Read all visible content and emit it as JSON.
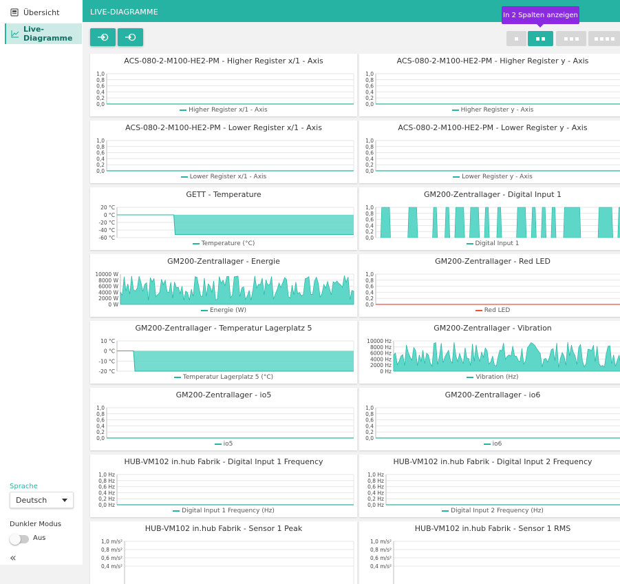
{
  "sidebar": {
    "items": [
      {
        "label": "Übersicht",
        "icon": "overview-icon",
        "active": false
      },
      {
        "label": "Live-Diagramme",
        "icon": "chart-line-icon",
        "active": true
      }
    ],
    "language_label": "Sprache",
    "language_value": "Deutsch",
    "dark_mode_label": "Dunkler Modus",
    "dark_mode_value": "Aus",
    "collapse_icon": "double-chevron-left-icon"
  },
  "header": {
    "title": "LIVE-DIAGRAMME",
    "tooltip": "In 2 Spalten anzeigen"
  },
  "toolbar": {
    "buttons": [
      "login-icon",
      "import-icon"
    ],
    "column_options": [
      1,
      2,
      3,
      4
    ],
    "selected_columns": 2
  },
  "colors": {
    "accent": "#26b3a3",
    "series": "#5ed6c8",
    "red": "#e0533f",
    "tooltip": "#8a2be2"
  },
  "charts": [
    {
      "title": "ACS-080-2-M100-HE2-PM - Higher Register x/1 - Axis",
      "legend": "Higher Register x/1 - Axis",
      "yticks": [
        "1,0",
        "0,8",
        "0,6",
        "0,4",
        "0,2",
        "0,0"
      ],
      "kind": "flat",
      "color": "#26b3a3"
    },
    {
      "title": "ACS-080-2-M100-HE2-PM - Higher Register y - Axis",
      "legend": "Higher Register y - Axis",
      "yticks": [
        "1,0",
        "0,8",
        "0,6",
        "0,4",
        "0,2",
        "0,0"
      ],
      "kind": "flat",
      "color": "#26b3a3"
    },
    {
      "title": "ACS-080-2-M100-HE2-PM - Lower Register x/1 - Axis",
      "legend": "Lower Register x/1 - Axis",
      "yticks": [
        "1,0",
        "0,8",
        "0,6",
        "0,4",
        "0,2",
        "0,0"
      ],
      "kind": "flat",
      "color": "#26b3a3"
    },
    {
      "title": "ACS-080-2-M100-HE2-PM - Lower Register y - Axis",
      "legend": "Lower Register y - Axis",
      "yticks": [
        "1,0",
        "0,8",
        "0,6",
        "0,4",
        "0,2",
        "0,0"
      ],
      "kind": "flat",
      "color": "#26b3a3"
    },
    {
      "title": "GETT - Temperature",
      "legend": "Temperature (°C)",
      "yticks": [
        "20 °C",
        "0 °C",
        "-20 °C",
        "-40 °C",
        "-60 °C"
      ],
      "kind": "temp",
      "step_at": 0.24,
      "drop_to": 0.9,
      "zero": 0.25,
      "color": "#26b3a3"
    },
    {
      "title": "GM200-Zentrallager - Digital Input 1",
      "legend": "Digital Input 1",
      "yticks": [
        "1,0",
        "0,8",
        "0,6",
        "0,4",
        "0,2",
        "0,0"
      ],
      "kind": "pulses",
      "pulses": [
        [
          0.02,
          0.06
        ],
        [
          0.13,
          0.17
        ],
        [
          0.23,
          0.25
        ],
        [
          0.28,
          0.3
        ],
        [
          0.32,
          0.36
        ],
        [
          0.38,
          0.42
        ],
        [
          0.44,
          0.46
        ],
        [
          0.49,
          0.51
        ],
        [
          0.57,
          0.61
        ],
        [
          0.63,
          0.65
        ],
        [
          0.67,
          0.69
        ],
        [
          0.71,
          0.73
        ],
        [
          0.76,
          0.83
        ],
        [
          0.9,
          0.96
        ],
        [
          0.98,
          1.0
        ]
      ],
      "color": "#26b3a3"
    },
    {
      "title": "GM200-Zentrallager - Energie",
      "legend": "Energie (W)",
      "yticks": [
        "10000 W",
        "8000 W",
        "6000 W",
        "4000 W",
        "2000 W",
        "0 W"
      ],
      "kind": "noisy",
      "seed": 3,
      "color": "#26b3a3"
    },
    {
      "title": "GM200-Zentrallager - Red LED",
      "legend": "Red LED",
      "yticks": [
        "1,0",
        "0,8",
        "0,6",
        "0,4",
        "0,2",
        "0,0"
      ],
      "kind": "flat",
      "color": "#e0533f"
    },
    {
      "title": "GM200-Zentrallager - Temperatur Lagerplatz 5",
      "legend": "Temperatur Lagerplatz 5 (°C)",
      "yticks": [
        "10 °C",
        "0 °C",
        "-10 °C",
        "-20 °C"
      ],
      "kind": "temp",
      "step_at": 0.07,
      "drop_to": 1.0,
      "zero": 0.33,
      "color": "#26b3a3"
    },
    {
      "title": "GM200-Zentrallager - Vibration",
      "legend": "Vibration (Hz)",
      "yticks": [
        "10000 Hz",
        "8000 Hz",
        "6000 Hz",
        "4000 Hz",
        "2000 Hz",
        "0 Hz"
      ],
      "kind": "noisy",
      "seed": 7,
      "color": "#26b3a3"
    },
    {
      "title": "GM200-Zentrallager - io5",
      "legend": "io5",
      "yticks": [
        "1,0",
        "0,8",
        "0,6",
        "0,4",
        "0,2",
        "0,0"
      ],
      "kind": "flat",
      "color": "#26b3a3"
    },
    {
      "title": "GM200-Zentrallager - io6",
      "legend": "io6",
      "yticks": [
        "1,0",
        "0,8",
        "0,6",
        "0,4",
        "0,2",
        "0,0"
      ],
      "kind": "flat",
      "color": "#26b3a3"
    },
    {
      "title": "HUB-VM102 in.hub Fabrik - Digital Input 1 Frequency",
      "legend": "Digital Input 1 Frequency (Hz)",
      "yticks": [
        "1,0 Hz",
        "0,8 Hz",
        "0,6 Hz",
        "0,4 Hz",
        "0,2 Hz",
        "0,0 Hz"
      ],
      "kind": "flat",
      "color": "#26b3a3"
    },
    {
      "title": "HUB-VM102 in.hub Fabrik - Digital Input 2 Frequency",
      "legend": "Digital Input 2 Frequency (Hz)",
      "yticks": [
        "1,0 Hz",
        "0,8 Hz",
        "0,6 Hz",
        "0,4 Hz",
        "0,2 Hz",
        "0,0 Hz"
      ],
      "kind": "flat",
      "color": "#26b3a3"
    },
    {
      "title": "HUB-VM102 in.hub Fabrik - Sensor 1 Peak",
      "legend": "",
      "yticks": [
        "1,0 m/s²",
        "0,8 m/s²",
        "0,6 m/s²",
        "0,4 m/s²"
      ],
      "kind": "partial",
      "color": "#26b3a3"
    },
    {
      "title": "HUB-VM102 in.hub Fabrik - Sensor 1 RMS",
      "legend": "",
      "yticks": [
        "1,0 m/s²",
        "0,8 m/s²",
        "0,6 m/s²",
        "0,4 m/s²"
      ],
      "kind": "partial",
      "color": "#26b3a3"
    }
  ]
}
